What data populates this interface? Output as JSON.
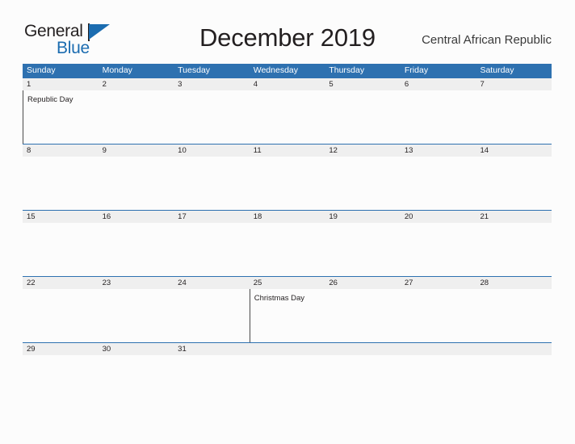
{
  "brand": {
    "line1": "General",
    "line2": "Blue",
    "flag_icon": "blue-triangle-flag"
  },
  "header": {
    "title": "December 2019",
    "region": "Central African Republic"
  },
  "colors": {
    "header_blue": "#2E71B0",
    "brand_blue": "#1B6CB0",
    "date_band": "#EFEFEF",
    "page_background": "#FCFCFC",
    "text": "#231F20"
  },
  "calendar": {
    "month": "December",
    "year": "2019",
    "weekday_headers": [
      "Sunday",
      "Monday",
      "Tuesday",
      "Wednesday",
      "Thursday",
      "Friday",
      "Saturday"
    ],
    "weeks": [
      {
        "dates": [
          "1",
          "2",
          "3",
          "4",
          "5",
          "6",
          "7"
        ],
        "events": [
          "Republic Day",
          "",
          "",
          "",
          "",
          "",
          ""
        ]
      },
      {
        "dates": [
          "8",
          "9",
          "10",
          "11",
          "12",
          "13",
          "14"
        ],
        "events": [
          "",
          "",
          "",
          "",
          "",
          "",
          ""
        ]
      },
      {
        "dates": [
          "15",
          "16",
          "17",
          "18",
          "19",
          "20",
          "21"
        ],
        "events": [
          "",
          "",
          "",
          "",
          "",
          "",
          ""
        ]
      },
      {
        "dates": [
          "22",
          "23",
          "24",
          "25",
          "26",
          "27",
          "28"
        ],
        "events": [
          "",
          "",
          "",
          "Christmas Day",
          "",
          "",
          ""
        ]
      },
      {
        "dates": [
          "29",
          "30",
          "31",
          "",
          "",
          "",
          ""
        ],
        "events": [
          "",
          "",
          "",
          "",
          "",
          "",
          ""
        ]
      }
    ]
  }
}
